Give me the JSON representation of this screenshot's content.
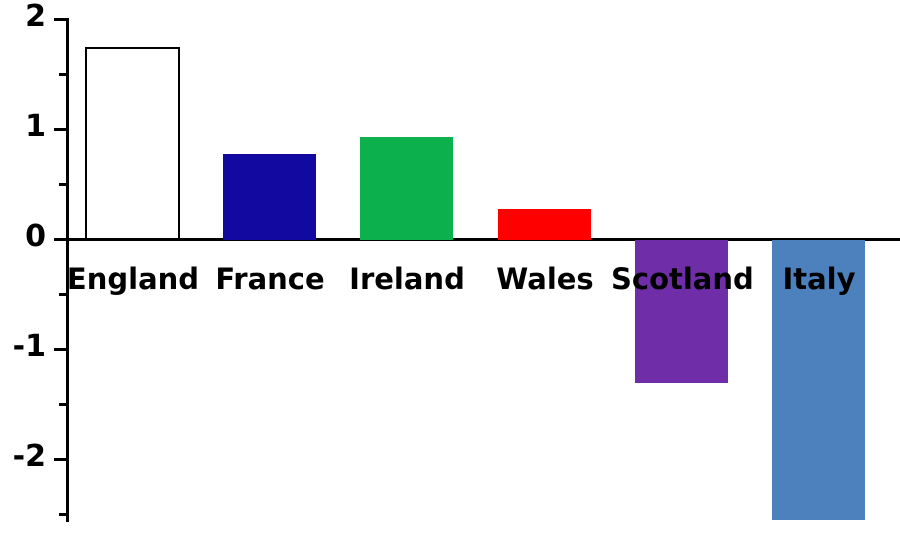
{
  "chart_data": {
    "type": "bar",
    "title": "",
    "xlabel": "",
    "ylabel": "",
    "categories": [
      "England",
      "France",
      "Ireland",
      "Wales",
      "Scotland",
      "Italy"
    ],
    "values": [
      1.74,
      0.76,
      0.92,
      0.26,
      -1.28,
      -2.55
    ],
    "colors": [
      "#ffffff",
      "#1209a0",
      "#0cb14e",
      "#ff0000",
      "#6f2da8",
      "#4c81be"
    ],
    "bar_edge_colors": [
      "#000000",
      "none",
      "none",
      "none",
      "none",
      "none"
    ],
    "ylim": [
      -2.58,
      2.0
    ],
    "ytick_labels": [
      "2",
      "1",
      "0",
      "-1",
      "-2"
    ],
    "ytick_values": [
      2,
      1,
      0,
      -1,
      -2
    ],
    "yminor_tick_values": [
      1.5,
      0.5,
      -0.5,
      -1.5,
      -2.5
    ],
    "grid": false,
    "legend": "none",
    "baseline_value": 0,
    "label_position": "below-zero-line"
  },
  "axis": {
    "zero_label": "0"
  }
}
